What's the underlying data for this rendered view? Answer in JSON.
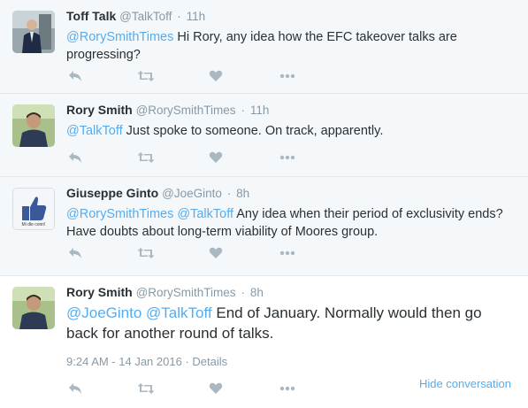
{
  "thread": {
    "tweets": [
      {
        "fullname": "Toff Talk",
        "screen_name": "@TalkToff",
        "separator": "·",
        "time": "11h",
        "mentions": [
          "@RorySmithTimes"
        ],
        "body": "Hi Rory, any idea how the EFC takeover talks are progressing?"
      },
      {
        "fullname": "Rory Smith",
        "screen_name": "@RorySmithTimes",
        "separator": "·",
        "time": "11h",
        "mentions": [
          "@TalkToff"
        ],
        "body": "Just spoke to someone. On track, apparently."
      },
      {
        "fullname": "Giuseppe Ginto",
        "screen_name": "@JoeGinto",
        "separator": "·",
        "time": "8h",
        "mentions": [
          "@RorySmithTimes",
          "@TalkToff"
        ],
        "body": "Any idea when their period of exclusivity ends? Have doubts about long-term viability of Moores group.",
        "avatar_caption": "Mi dle conn!"
      },
      {
        "fullname": "Rory Smith",
        "screen_name": "@RorySmithTimes",
        "separator": "·",
        "time": "8h",
        "mentions": [
          "@JoeGinto",
          "@TalkToff"
        ],
        "body": "End of January. Normally would then go back for another round of talks.",
        "timestamp": "9:24 AM - 14 Jan 2016",
        "meta_separator": "·",
        "details_label": "Details",
        "hide_label": "Hide conversation"
      }
    ]
  },
  "icons": [
    "reply-icon",
    "retweet-icon",
    "like-icon",
    "more-icon"
  ],
  "colors": {
    "link": "#55acee",
    "muted": "#8899a6",
    "context_bg": "#f5f8fa",
    "border": "#e1e8ed"
  }
}
